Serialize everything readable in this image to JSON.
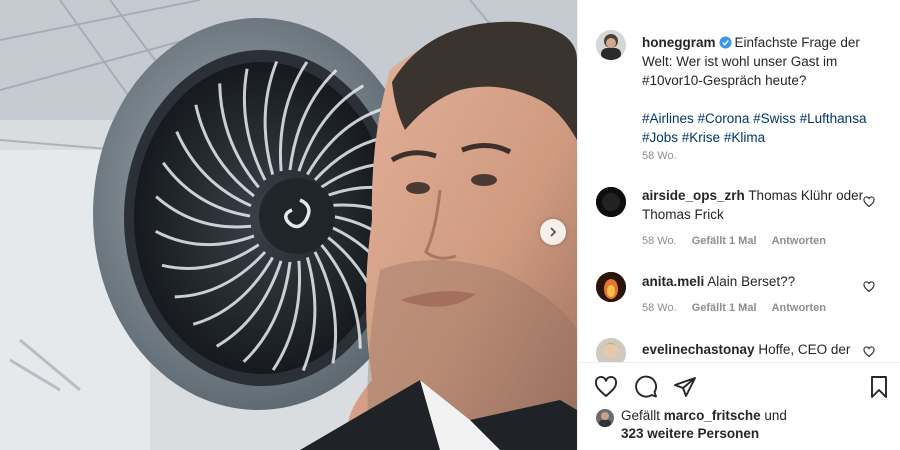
{
  "post": {
    "author": "honeggram",
    "caption": "Einfachste Frage der Welt: Wer ist wohl unser Gast im #10vor10-Gespräch heute?",
    "hashtags": [
      "#Airlines",
      "#Corona",
      "#Swiss",
      "#Lufthansa",
      "#Jobs",
      "#Krise",
      "#Klima"
    ],
    "age": "58 Wo."
  },
  "comments": [
    {
      "user": "airside_ops_zrh",
      "text": "Thomas Klühr oder Thomas Frick",
      "age": "58 Wo.",
      "likes": "Gefällt 1 Mal",
      "reply": "Antworten"
    },
    {
      "user": "anita.meli",
      "text": "Alain Berset??",
      "age": "58 Wo.",
      "likes": "Gefällt 1 Mal",
      "reply": "Antworten"
    },
    {
      "user": "evelinechastonay",
      "text": "Hoffe, CEO der"
    }
  ],
  "likes": {
    "prefix": "Gefällt",
    "user": "marco_fritsche",
    "joiner": "und",
    "others": "323 weitere Personen"
  },
  "colors": {
    "verified": "#3897f0",
    "hashtag": "#00376b",
    "meta": "#8e8e8e"
  },
  "icons": [
    "next-arrow-icon",
    "verified-badge-icon",
    "heart-icon",
    "comment-icon",
    "share-icon",
    "bookmark-icon"
  ]
}
